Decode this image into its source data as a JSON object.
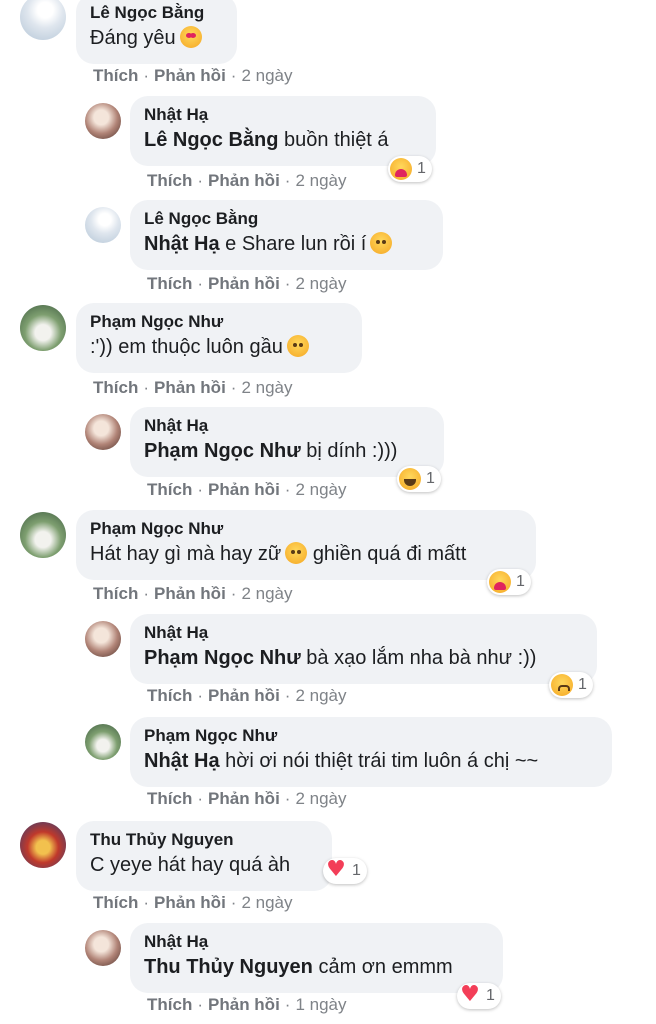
{
  "labels": {
    "like": "Thích",
    "reply": "Phản hồi",
    "sep": "·"
  },
  "comments": [
    {
      "name": "Lê Ngọc Bằng",
      "tag": "",
      "text": "Đáng yêu",
      "emoji": "heart-eyes",
      "time": "2 ngày",
      "reaction": null
    },
    {
      "name": "Nhật Hạ",
      "tag": "Lê Ngọc Bằng",
      "text": "buồn thiệt á",
      "emoji": null,
      "time": "2 ngày",
      "reaction": {
        "icon": "care",
        "count": "1"
      }
    },
    {
      "name": "Lê Ngọc Bằng",
      "tag": "Nhật Hạ",
      "text": "e Share lun rồi í",
      "emoji": "smiling",
      "time": "2 ngày",
      "reaction": null
    },
    {
      "name": "Phạm Ngọc Như",
      "tag": "",
      "text": ":')) em thuộc luôn gầu",
      "emoji": "relieved",
      "time": "2 ngày",
      "reaction": null
    },
    {
      "name": "Nhật Hạ",
      "tag": "Phạm Ngọc Như",
      "text": "bị dính :)))",
      "emoji": null,
      "time": "2 ngày",
      "reaction": {
        "icon": "haha",
        "count": "1"
      }
    },
    {
      "name": "Phạm Ngọc Như",
      "tag": "",
      "text": "Hát hay gì mà hay zữ",
      "emoji": "relieved",
      "text2": "ghiền quá đi mấtt",
      "time": "2 ngày",
      "reaction": {
        "icon": "care",
        "count": "1"
      }
    },
    {
      "name": "Nhật Hạ",
      "tag": "Phạm Ngọc Như",
      "text": "bà xạo lắm nha bà như :))",
      "emoji": null,
      "time": "2 ngày",
      "reaction": {
        "icon": "sad",
        "count": "1"
      }
    },
    {
      "name": "Phạm Ngọc Như",
      "tag": "Nhật Hạ",
      "text": "hời ơi nói thiệt trái tim luôn á chị ~~",
      "emoji": null,
      "time": "2 ngày",
      "reaction": null
    },
    {
      "name": "Thu Thủy Nguyen",
      "tag": "",
      "text": "C yeye hát hay quá àh",
      "emoji": null,
      "time": "2 ngày",
      "reaction": {
        "icon": "heart",
        "count": "1"
      }
    },
    {
      "name": "Nhật Hạ",
      "tag": "Thu Thủy Nguyen",
      "text": "cảm ơn emmm",
      "emoji": null,
      "time": "1 ngày",
      "reaction": {
        "icon": "heart",
        "count": "1"
      }
    }
  ]
}
